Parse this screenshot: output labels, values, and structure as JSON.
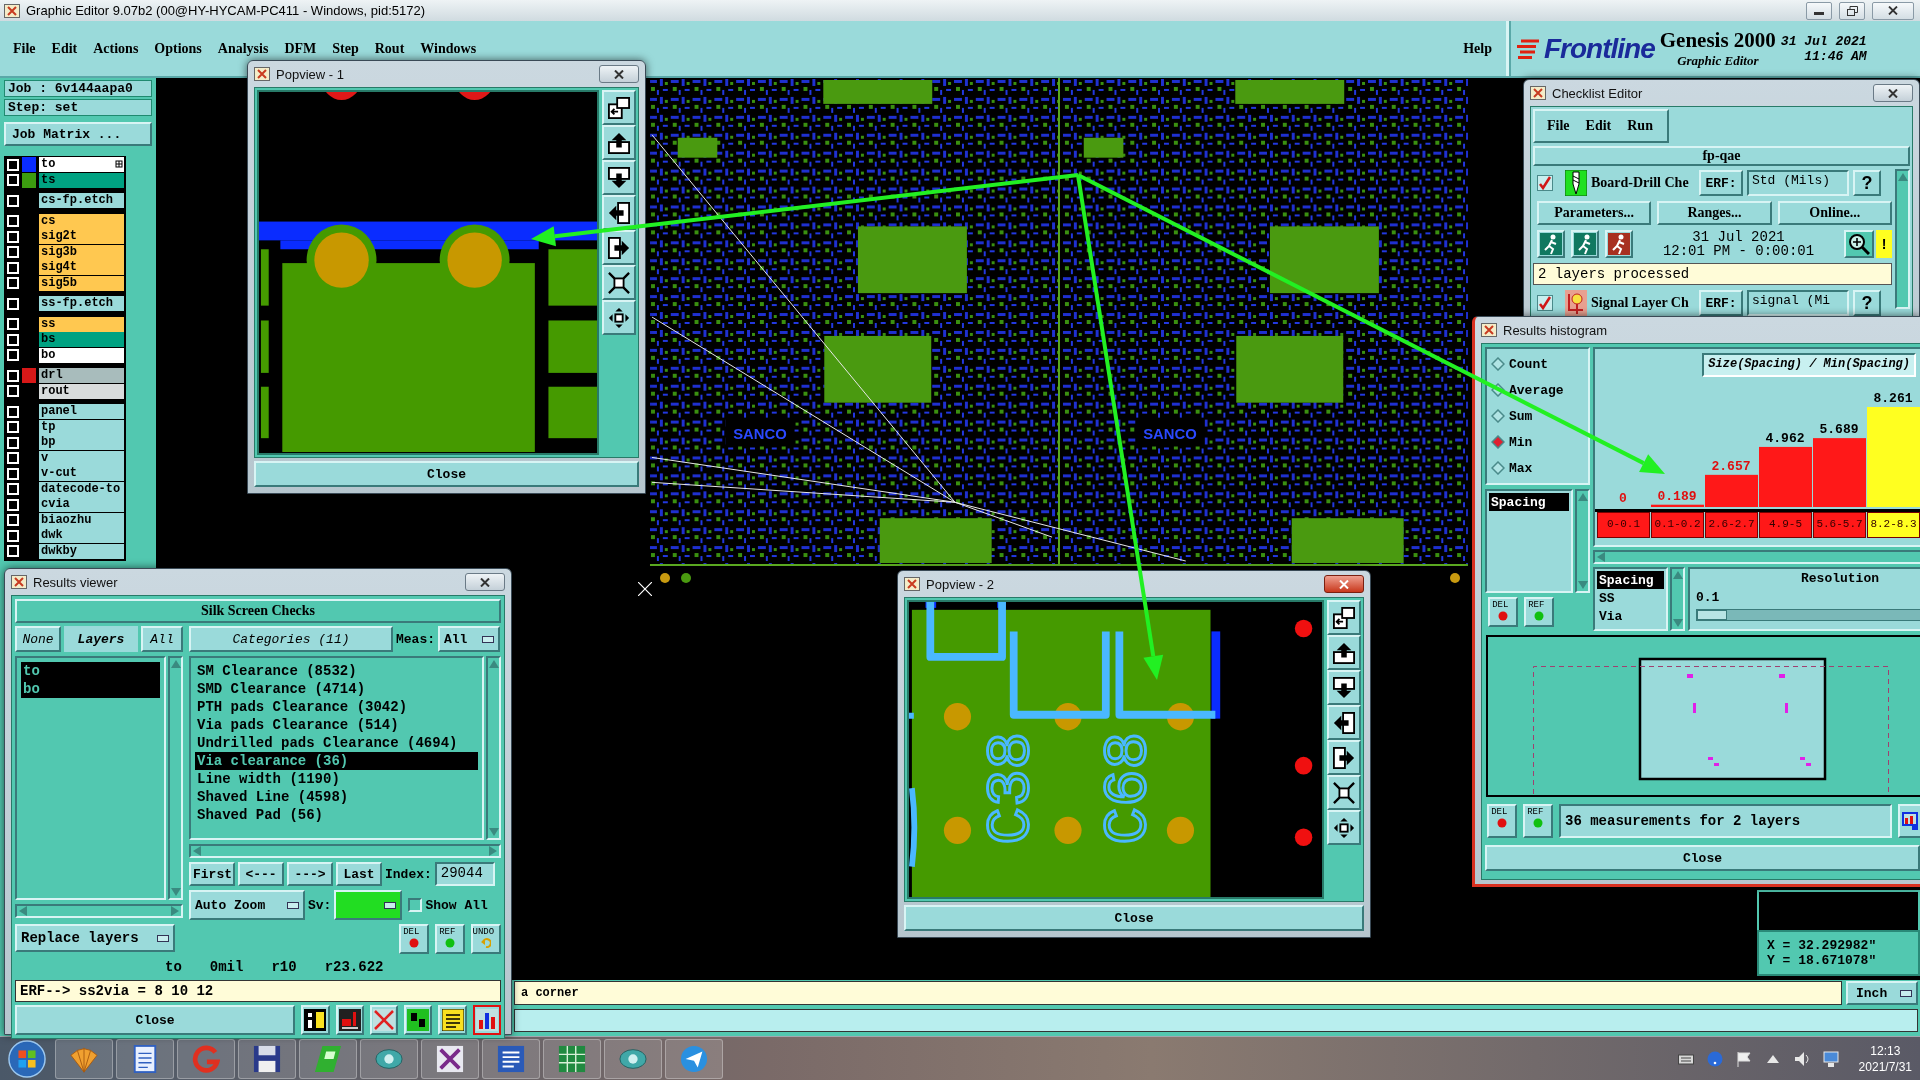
{
  "window": {
    "title": "Graphic Editor 9.07b2 (00@HY-HYCAM-PC411 - Windows, pid:5172)"
  },
  "menu": [
    "File",
    "Edit",
    "Actions",
    "Options",
    "Analysis",
    "DFM",
    "Step",
    "Rout",
    "Windows"
  ],
  "help": "Help",
  "brand": {
    "logo": "Frontline",
    "product": "Genesis 2000",
    "subtitle": "Graphic Editor",
    "date": "31 Jul 2021",
    "time": "11:46 AM"
  },
  "job": {
    "job": "Job : 6v144aapa0",
    "step": "Step: set",
    "matrix_button": "Job Matrix ..."
  },
  "layer_groups": [
    {
      "layers": [
        {
          "name": "to",
          "color": "#ffffff",
          "swatch": {
            "color": "#0a2cff"
          },
          "checked": false,
          "work": true
        },
        {
          "name": "ts",
          "color": "#00a282",
          "swatch": {
            "color": "#3c9c10"
          },
          "checked": false,
          "work": false
        }
      ]
    },
    {
      "layers": [
        {
          "name": "cs-fp.etch",
          "color": "#9adada",
          "checked": false,
          "work": false
        }
      ]
    },
    {
      "layers": [
        {
          "name": "cs",
          "color": "#ffc850",
          "checked": false,
          "work": false
        },
        {
          "name": "sig2t",
          "color": "#ffc850",
          "checked": false,
          "work": false
        },
        {
          "name": "sig3b",
          "color": "#ffc850",
          "checked": false,
          "work": false
        },
        {
          "name": "sig4t",
          "color": "#ffc850",
          "checked": false,
          "work": false
        },
        {
          "name": "sig5b",
          "color": "#ffc850",
          "checked": false,
          "work": false
        }
      ]
    },
    {
      "layers": [
        {
          "name": "ss-fp.etch",
          "color": "#9adada",
          "checked": false,
          "work": false
        }
      ]
    },
    {
      "layers": [
        {
          "name": "ss",
          "color": "#ffc850",
          "checked": false,
          "work": false
        },
        {
          "name": "bs",
          "color": "#00a282",
          "checked": false,
          "work": false
        },
        {
          "name": "bo",
          "color": "#ffffff",
          "checked": false,
          "work": false
        }
      ]
    },
    {
      "layers": [
        {
          "name": "drl",
          "color": "#a8bcbc",
          "swatch": {
            "color": "#d81818"
          },
          "checked": false,
          "work": false
        },
        {
          "name": "rout",
          "color": "#d8dcdc",
          "checked": false,
          "work": false
        }
      ]
    },
    {
      "layers": [
        {
          "name": "panel",
          "color": "#9adada",
          "checked": false,
          "work": false
        },
        {
          "name": "tp",
          "color": "#9adada",
          "checked": false,
          "work": false
        },
        {
          "name": "bp",
          "color": "#9adada",
          "checked": false,
          "work": false
        },
        {
          "name": "v",
          "color": "#9adada",
          "checked": false,
          "work": false
        },
        {
          "name": "v-cut",
          "color": "#9adada",
          "checked": false,
          "work": false
        },
        {
          "name": "datecode-to",
          "color": "#9adada",
          "checked": false,
          "work": false
        },
        {
          "name": "cvia",
          "color": "#9adada",
          "checked": false,
          "work": false
        },
        {
          "name": "biaozhu",
          "color": "#9adada",
          "checked": false,
          "work": false
        },
        {
          "name": "dwk",
          "color": "#9adada",
          "checked": false,
          "work": false
        },
        {
          "name": "dwkby",
          "color": "#9adada",
          "checked": false,
          "work": false
        }
      ]
    }
  ],
  "pcb": {
    "labels": [
      "SANCO",
      "SANCO"
    ]
  },
  "status": {
    "message": "a corner",
    "units": "Inch",
    "x": "X = 32.292982\"",
    "y": "Y = 18.671078\""
  },
  "popview_1": {
    "title": "Popview - 1",
    "active": false,
    "close": "Close"
  },
  "popview_2": {
    "title": "Popview - 2",
    "active": true,
    "close": "Close",
    "silkscreen_labels": [
      "C38",
      "C68"
    ]
  },
  "results_viewer": {
    "title": "Results viewer",
    "heading": "Silk Screen Checks",
    "none_button": "None",
    "layers_label": "Layers",
    "all_button": "All",
    "categories_label": "Categories (11)",
    "meas_label": "Meas:",
    "meas_value": "All",
    "layers": [
      {
        "name": "to",
        "selected": true
      },
      {
        "name": "bo",
        "selected": true
      }
    ],
    "categories": [
      {
        "label": "SM Clearance (8532)",
        "selected": false
      },
      {
        "label": "SMD Clearance (4714)",
        "selected": false
      },
      {
        "label": "PTH pads Clearance (3042)",
        "selected": false
      },
      {
        "label": "Via pads Clearance (514)",
        "selected": false
      },
      {
        "label": "Undrilled pads Clearance (4694)",
        "selected": false
      },
      {
        "label": "Via clearance (36)",
        "selected": true
      },
      {
        "label": "Line width (1190)",
        "selected": false
      },
      {
        "label": "Shaved Line (4598)",
        "selected": false
      },
      {
        "label": "Shaved Pad (56)",
        "selected": false
      }
    ],
    "nav": [
      "First",
      "<---",
      "--->",
      "Last"
    ],
    "index_label": "Index:",
    "index_value": "29044",
    "zoom_mode": "Auto Zoom",
    "sv_label": "Sv:",
    "show_all": {
      "label": "Show All",
      "checked": false
    },
    "action_buttons": [
      {
        "label": "DEL",
        "kind": "delete"
      },
      {
        "label": "REF",
        "kind": "reference"
      },
      {
        "label": "UNDO",
        "kind": "undo"
      }
    ],
    "replace_mode": "Replace layers",
    "info": [
      "to",
      "0mil",
      "r10",
      "r23.622"
    ],
    "erf_line": "ERF--> ss2via = 8 10 12",
    "close": "Close"
  },
  "checklist": {
    "title": "Checklist Editor",
    "menu": [
      "File",
      "Edit",
      "Run"
    ],
    "name": "fp-qae",
    "checks": [
      {
        "name": "Board-Drill Che",
        "kind": "drill",
        "checked": true,
        "erf_label": "ERF:",
        "erf": "Std (Mils)",
        "help": "?",
        "details": {
          "buttons": [
            "Parameters...",
            "Ranges...",
            "Online..."
          ],
          "date": "31 Jul 2021",
          "time": "12:01 PM - 0:00:01",
          "warning": "!",
          "status": "2 layers processed"
        }
      },
      {
        "name": "Signal Layer Ch",
        "kind": "signal",
        "checked": true,
        "erf_label": "ERF:",
        "erf": "signal (Mi",
        "help": "?"
      }
    ]
  },
  "histogram": {
    "title": "Results histogram",
    "modes": [
      {
        "label": "Count",
        "selected": false
      },
      {
        "label": "Average",
        "selected": false
      },
      {
        "label": "Sum",
        "selected": false
      },
      {
        "label": "Min",
        "selected": true
      },
      {
        "label": "Max",
        "selected": false
      }
    ],
    "measures": [
      {
        "label": "Spacing",
        "selected": true
      }
    ],
    "chart_data": {
      "type": "bar",
      "title": "Size(Spacing) / Min(Spacing)",
      "categories": [
        "0-0.1",
        "0.1-0.2",
        "2.6-2.7",
        "4.9-5",
        "5.6-5.7",
        "8.2-8.3"
      ],
      "values": [
        0,
        0.189,
        2.657,
        4.962,
        5.689,
        8.261
      ],
      "data_labels": true
    },
    "bins": [
      {
        "selected": false,
        "flagged": true
      },
      {
        "selected": false,
        "flagged": true
      },
      {
        "selected": false,
        "flagged": true
      },
      {
        "selected": false,
        "flagged": false
      },
      {
        "selected": false,
        "flagged": false
      },
      {
        "selected": true,
        "flagged": false
      }
    ],
    "attributes": [
      {
        "label": "Spacing",
        "selected": true
      },
      {
        "label": "SS",
        "selected": false
      },
      {
        "label": "Via",
        "selected": false
      }
    ],
    "resolution_label": "Resolution",
    "resolution_value": "0.1",
    "resolution": {
      "level": 0
    },
    "action_buttons": [
      {
        "label": "DEL",
        "kind": "delete"
      },
      {
        "label": "REF",
        "kind": "reference"
      }
    ],
    "footer_buttons": [
      {
        "label": "DEL",
        "kind": "delete"
      },
      {
        "label": "REF",
        "kind": "reference"
      }
    ],
    "summary": "36 measurements for 2 layers",
    "close": "Close"
  },
  "taskbar": {
    "time": "12:13",
    "date": "2021/7/31"
  }
}
